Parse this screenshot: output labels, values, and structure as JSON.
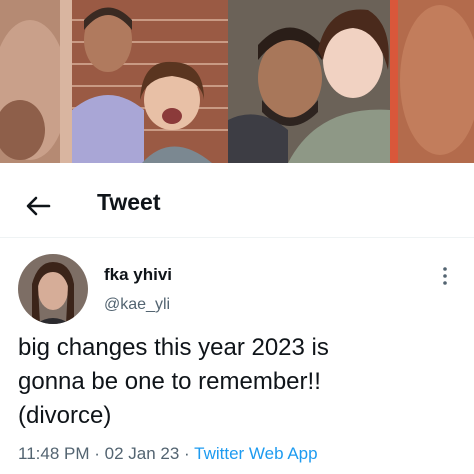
{
  "header": {
    "title": "Tweet",
    "back_icon": "arrow-left-icon"
  },
  "tweet": {
    "display_name": "fka yhivi",
    "handle": "@kae_yli",
    "text_lines": [
      "big changes this year 2023 is",
      "gonna be one to remember!!",
      "(divorce)"
    ],
    "time": "11:48 PM",
    "separator_1": " · ",
    "date": "02 Jan 23",
    "separator_2": " · ",
    "source": "Twitter Web App",
    "more_icon": "more-vertical-icon"
  },
  "colors": {
    "text_primary": "#0f1419",
    "text_secondary": "#536471",
    "link": "#1d9bf0"
  }
}
